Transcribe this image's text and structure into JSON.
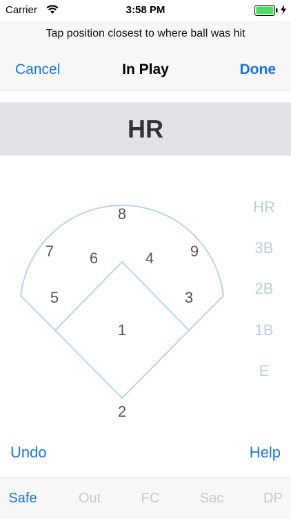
{
  "status_bar": {
    "carrier": "Carrier",
    "time": "3:58 PM",
    "battery_color": "#4cd964"
  },
  "header": {
    "prompt": "Tap position closest to where ball was hit",
    "cancel_label": "Cancel",
    "title": "In Play",
    "done_label": "Done"
  },
  "result": "HR",
  "field": {
    "positions": [
      "1",
      "2",
      "3",
      "4",
      "5",
      "6",
      "7",
      "8",
      "9"
    ],
    "line_color": "#b8d3ee"
  },
  "hit_types": [
    "HR",
    "3B",
    "2B",
    "1B",
    "E"
  ],
  "actions": {
    "undo_label": "Undo",
    "help_label": "Help"
  },
  "tabs": [
    {
      "label": "Safe",
      "active": true
    },
    {
      "label": "Out",
      "active": false
    },
    {
      "label": "FC",
      "active": false
    },
    {
      "label": "Sac",
      "active": false
    },
    {
      "label": "DP",
      "active": false
    }
  ],
  "colors": {
    "accent": "#1a73e8",
    "inactive": "#c8c8c8",
    "hit_type": "#b8cde4"
  }
}
